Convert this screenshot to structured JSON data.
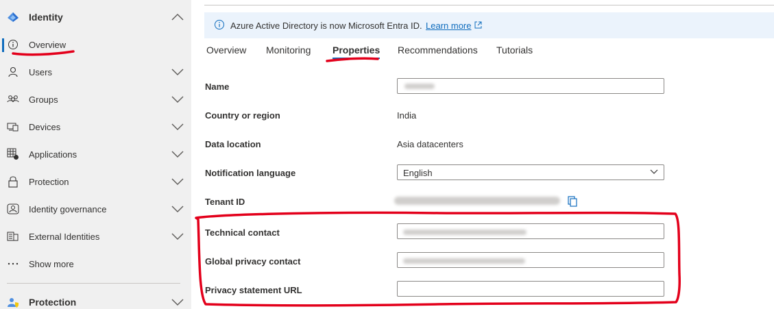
{
  "sidebar": {
    "header": {
      "label": "Identity",
      "icon": "entra-diamond-icon"
    },
    "items": [
      {
        "label": "Overview",
        "icon": "info-icon"
      },
      {
        "label": "Users",
        "icon": "person-icon"
      },
      {
        "label": "Groups",
        "icon": "people-icon"
      },
      {
        "label": "Devices",
        "icon": "devices-icon"
      },
      {
        "label": "Applications",
        "icon": "apps-icon"
      },
      {
        "label": "Protection",
        "icon": "lock-icon"
      },
      {
        "label": "Identity governance",
        "icon": "governance-icon"
      },
      {
        "label": "External Identities",
        "icon": "external-identities-icon"
      },
      {
        "label": "Show more",
        "icon": "ellipsis-icon"
      }
    ],
    "section": {
      "label": "Protection",
      "icon": "protection-person-icon"
    }
  },
  "banner": {
    "message": "Azure Active Directory is now Microsoft Entra ID.",
    "link": "Learn more"
  },
  "tabs": [
    {
      "label": "Overview"
    },
    {
      "label": "Monitoring"
    },
    {
      "label": "Properties",
      "active": true
    },
    {
      "label": "Recommendations"
    },
    {
      "label": "Tutorials"
    }
  ],
  "properties": {
    "name_label": "Name",
    "country_label": "Country or region",
    "country_value": "India",
    "data_location_label": "Data location",
    "data_location_value": "Asia datacenters",
    "notification_label": "Notification language",
    "notification_value": "English",
    "tenant_label": "Tenant ID",
    "technical_label": "Technical contact",
    "privacy_contact_label": "Global privacy contact",
    "privacy_url_label": "Privacy statement URL"
  },
  "colors": {
    "accent": "#0f6cbd",
    "annotation_red": "#e3001b",
    "sidebar_bg": "#f0f0f0",
    "banner_bg": "#ebf3fc"
  }
}
